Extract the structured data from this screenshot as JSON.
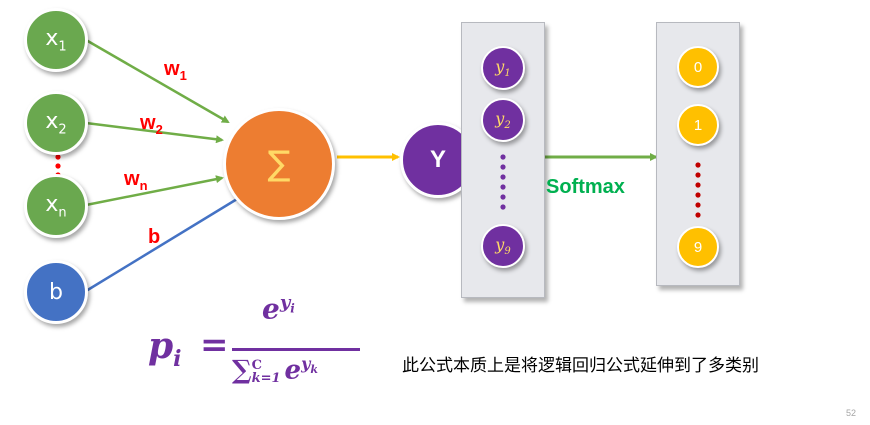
{
  "inputs": {
    "x1": {
      "base": "x",
      "sub": "1"
    },
    "x2": {
      "base": "x",
      "sub": "2"
    },
    "xn": {
      "base": "x",
      "sub": "n"
    },
    "bias": "b"
  },
  "weights": {
    "w1": {
      "base": "w",
      "sub": "1"
    },
    "w2": {
      "base": "w",
      "sub": "2"
    },
    "wn": {
      "base": "w",
      "sub": "n"
    },
    "b": "b"
  },
  "sum_symbol": "∑",
  "output_node": "Y",
  "logits": [
    {
      "base": "y",
      "sub": "1"
    },
    {
      "base": "y",
      "sub": "2"
    },
    {
      "base": "y",
      "sub": "9"
    }
  ],
  "softmax_label": "Softmax",
  "probabilities": [
    "0",
    "1",
    "9"
  ],
  "formula": {
    "lhs_base": "p",
    "lhs_sub": "i",
    "equals": "=",
    "num_base": "e",
    "num_exp_base": "y",
    "num_exp_sub": "i",
    "den_sum": "∑",
    "den_sub": "k=1",
    "den_sup": "C",
    "den_base": "e",
    "den_exp_base": "y",
    "den_exp_sub": "k"
  },
  "caption": "此公式本质上是将逻辑回归公式延伸到了多类别",
  "page_number": "52",
  "colors": {
    "input_node": "#6aa84f",
    "bias_node": "#4472c4",
    "sum_node": "#ed7d31",
    "logit_node": "#7030a0",
    "prob_node": "#ffc000",
    "weight_label": "#ff0000",
    "softmax_label": "#00b050",
    "formula": "#7030a0"
  }
}
